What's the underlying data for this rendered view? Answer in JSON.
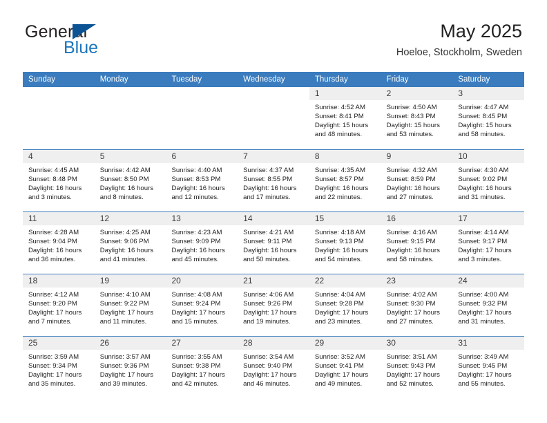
{
  "logo": {
    "word_general": "General",
    "word_blue": "Blue"
  },
  "header": {
    "title": "May 2025",
    "subtitle": "Hoeloe, Stockholm, Sweden"
  },
  "calendar": {
    "weekday_headers": [
      "Sunday",
      "Monday",
      "Tuesday",
      "Wednesday",
      "Thursday",
      "Friday",
      "Saturday"
    ],
    "colors": {
      "header_blue": "#3a7cbe",
      "band_gray": "#efefef",
      "logo_blue": "#1b75bb",
      "triangle_blue": "#0b5394"
    },
    "weeks": [
      [
        {
          "day": "",
          "sunrise": "",
          "sunset": "",
          "daylight_line1": "",
          "daylight_line2": ""
        },
        {
          "day": "",
          "sunrise": "",
          "sunset": "",
          "daylight_line1": "",
          "daylight_line2": ""
        },
        {
          "day": "",
          "sunrise": "",
          "sunset": "",
          "daylight_line1": "",
          "daylight_line2": ""
        },
        {
          "day": "",
          "sunrise": "",
          "sunset": "",
          "daylight_line1": "",
          "daylight_line2": ""
        },
        {
          "day": "1",
          "sunrise": "Sunrise: 4:52 AM",
          "sunset": "Sunset: 8:41 PM",
          "daylight_line1": "Daylight: 15 hours",
          "daylight_line2": "and 48 minutes."
        },
        {
          "day": "2",
          "sunrise": "Sunrise: 4:50 AM",
          "sunset": "Sunset: 8:43 PM",
          "daylight_line1": "Daylight: 15 hours",
          "daylight_line2": "and 53 minutes."
        },
        {
          "day": "3",
          "sunrise": "Sunrise: 4:47 AM",
          "sunset": "Sunset: 8:45 PM",
          "daylight_line1": "Daylight: 15 hours",
          "daylight_line2": "and 58 minutes."
        }
      ],
      [
        {
          "day": "4",
          "sunrise": "Sunrise: 4:45 AM",
          "sunset": "Sunset: 8:48 PM",
          "daylight_line1": "Daylight: 16 hours",
          "daylight_line2": "and 3 minutes."
        },
        {
          "day": "5",
          "sunrise": "Sunrise: 4:42 AM",
          "sunset": "Sunset: 8:50 PM",
          "daylight_line1": "Daylight: 16 hours",
          "daylight_line2": "and 8 minutes."
        },
        {
          "day": "6",
          "sunrise": "Sunrise: 4:40 AM",
          "sunset": "Sunset: 8:53 PM",
          "daylight_line1": "Daylight: 16 hours",
          "daylight_line2": "and 12 minutes."
        },
        {
          "day": "7",
          "sunrise": "Sunrise: 4:37 AM",
          "sunset": "Sunset: 8:55 PM",
          "daylight_line1": "Daylight: 16 hours",
          "daylight_line2": "and 17 minutes."
        },
        {
          "day": "8",
          "sunrise": "Sunrise: 4:35 AM",
          "sunset": "Sunset: 8:57 PM",
          "daylight_line1": "Daylight: 16 hours",
          "daylight_line2": "and 22 minutes."
        },
        {
          "day": "9",
          "sunrise": "Sunrise: 4:32 AM",
          "sunset": "Sunset: 8:59 PM",
          "daylight_line1": "Daylight: 16 hours",
          "daylight_line2": "and 27 minutes."
        },
        {
          "day": "10",
          "sunrise": "Sunrise: 4:30 AM",
          "sunset": "Sunset: 9:02 PM",
          "daylight_line1": "Daylight: 16 hours",
          "daylight_line2": "and 31 minutes."
        }
      ],
      [
        {
          "day": "11",
          "sunrise": "Sunrise: 4:28 AM",
          "sunset": "Sunset: 9:04 PM",
          "daylight_line1": "Daylight: 16 hours",
          "daylight_line2": "and 36 minutes."
        },
        {
          "day": "12",
          "sunrise": "Sunrise: 4:25 AM",
          "sunset": "Sunset: 9:06 PM",
          "daylight_line1": "Daylight: 16 hours",
          "daylight_line2": "and 41 minutes."
        },
        {
          "day": "13",
          "sunrise": "Sunrise: 4:23 AM",
          "sunset": "Sunset: 9:09 PM",
          "daylight_line1": "Daylight: 16 hours",
          "daylight_line2": "and 45 minutes."
        },
        {
          "day": "14",
          "sunrise": "Sunrise: 4:21 AM",
          "sunset": "Sunset: 9:11 PM",
          "daylight_line1": "Daylight: 16 hours",
          "daylight_line2": "and 50 minutes."
        },
        {
          "day": "15",
          "sunrise": "Sunrise: 4:18 AM",
          "sunset": "Sunset: 9:13 PM",
          "daylight_line1": "Daylight: 16 hours",
          "daylight_line2": "and 54 minutes."
        },
        {
          "day": "16",
          "sunrise": "Sunrise: 4:16 AM",
          "sunset": "Sunset: 9:15 PM",
          "daylight_line1": "Daylight: 16 hours",
          "daylight_line2": "and 58 minutes."
        },
        {
          "day": "17",
          "sunrise": "Sunrise: 4:14 AM",
          "sunset": "Sunset: 9:17 PM",
          "daylight_line1": "Daylight: 17 hours",
          "daylight_line2": "and 3 minutes."
        }
      ],
      [
        {
          "day": "18",
          "sunrise": "Sunrise: 4:12 AM",
          "sunset": "Sunset: 9:20 PM",
          "daylight_line1": "Daylight: 17 hours",
          "daylight_line2": "and 7 minutes."
        },
        {
          "day": "19",
          "sunrise": "Sunrise: 4:10 AM",
          "sunset": "Sunset: 9:22 PM",
          "daylight_line1": "Daylight: 17 hours",
          "daylight_line2": "and 11 minutes."
        },
        {
          "day": "20",
          "sunrise": "Sunrise: 4:08 AM",
          "sunset": "Sunset: 9:24 PM",
          "daylight_line1": "Daylight: 17 hours",
          "daylight_line2": "and 15 minutes."
        },
        {
          "day": "21",
          "sunrise": "Sunrise: 4:06 AM",
          "sunset": "Sunset: 9:26 PM",
          "daylight_line1": "Daylight: 17 hours",
          "daylight_line2": "and 19 minutes."
        },
        {
          "day": "22",
          "sunrise": "Sunrise: 4:04 AM",
          "sunset": "Sunset: 9:28 PM",
          "daylight_line1": "Daylight: 17 hours",
          "daylight_line2": "and 23 minutes."
        },
        {
          "day": "23",
          "sunrise": "Sunrise: 4:02 AM",
          "sunset": "Sunset: 9:30 PM",
          "daylight_line1": "Daylight: 17 hours",
          "daylight_line2": "and 27 minutes."
        },
        {
          "day": "24",
          "sunrise": "Sunrise: 4:00 AM",
          "sunset": "Sunset: 9:32 PM",
          "daylight_line1": "Daylight: 17 hours",
          "daylight_line2": "and 31 minutes."
        }
      ],
      [
        {
          "day": "25",
          "sunrise": "Sunrise: 3:59 AM",
          "sunset": "Sunset: 9:34 PM",
          "daylight_line1": "Daylight: 17 hours",
          "daylight_line2": "and 35 minutes."
        },
        {
          "day": "26",
          "sunrise": "Sunrise: 3:57 AM",
          "sunset": "Sunset: 9:36 PM",
          "daylight_line1": "Daylight: 17 hours",
          "daylight_line2": "and 39 minutes."
        },
        {
          "day": "27",
          "sunrise": "Sunrise: 3:55 AM",
          "sunset": "Sunset: 9:38 PM",
          "daylight_line1": "Daylight: 17 hours",
          "daylight_line2": "and 42 minutes."
        },
        {
          "day": "28",
          "sunrise": "Sunrise: 3:54 AM",
          "sunset": "Sunset: 9:40 PM",
          "daylight_line1": "Daylight: 17 hours",
          "daylight_line2": "and 46 minutes."
        },
        {
          "day": "29",
          "sunrise": "Sunrise: 3:52 AM",
          "sunset": "Sunset: 9:41 PM",
          "daylight_line1": "Daylight: 17 hours",
          "daylight_line2": "and 49 minutes."
        },
        {
          "day": "30",
          "sunrise": "Sunrise: 3:51 AM",
          "sunset": "Sunset: 9:43 PM",
          "daylight_line1": "Daylight: 17 hours",
          "daylight_line2": "and 52 minutes."
        },
        {
          "day": "31",
          "sunrise": "Sunrise: 3:49 AM",
          "sunset": "Sunset: 9:45 PM",
          "daylight_line1": "Daylight: 17 hours",
          "daylight_line2": "and 55 minutes."
        }
      ]
    ]
  }
}
